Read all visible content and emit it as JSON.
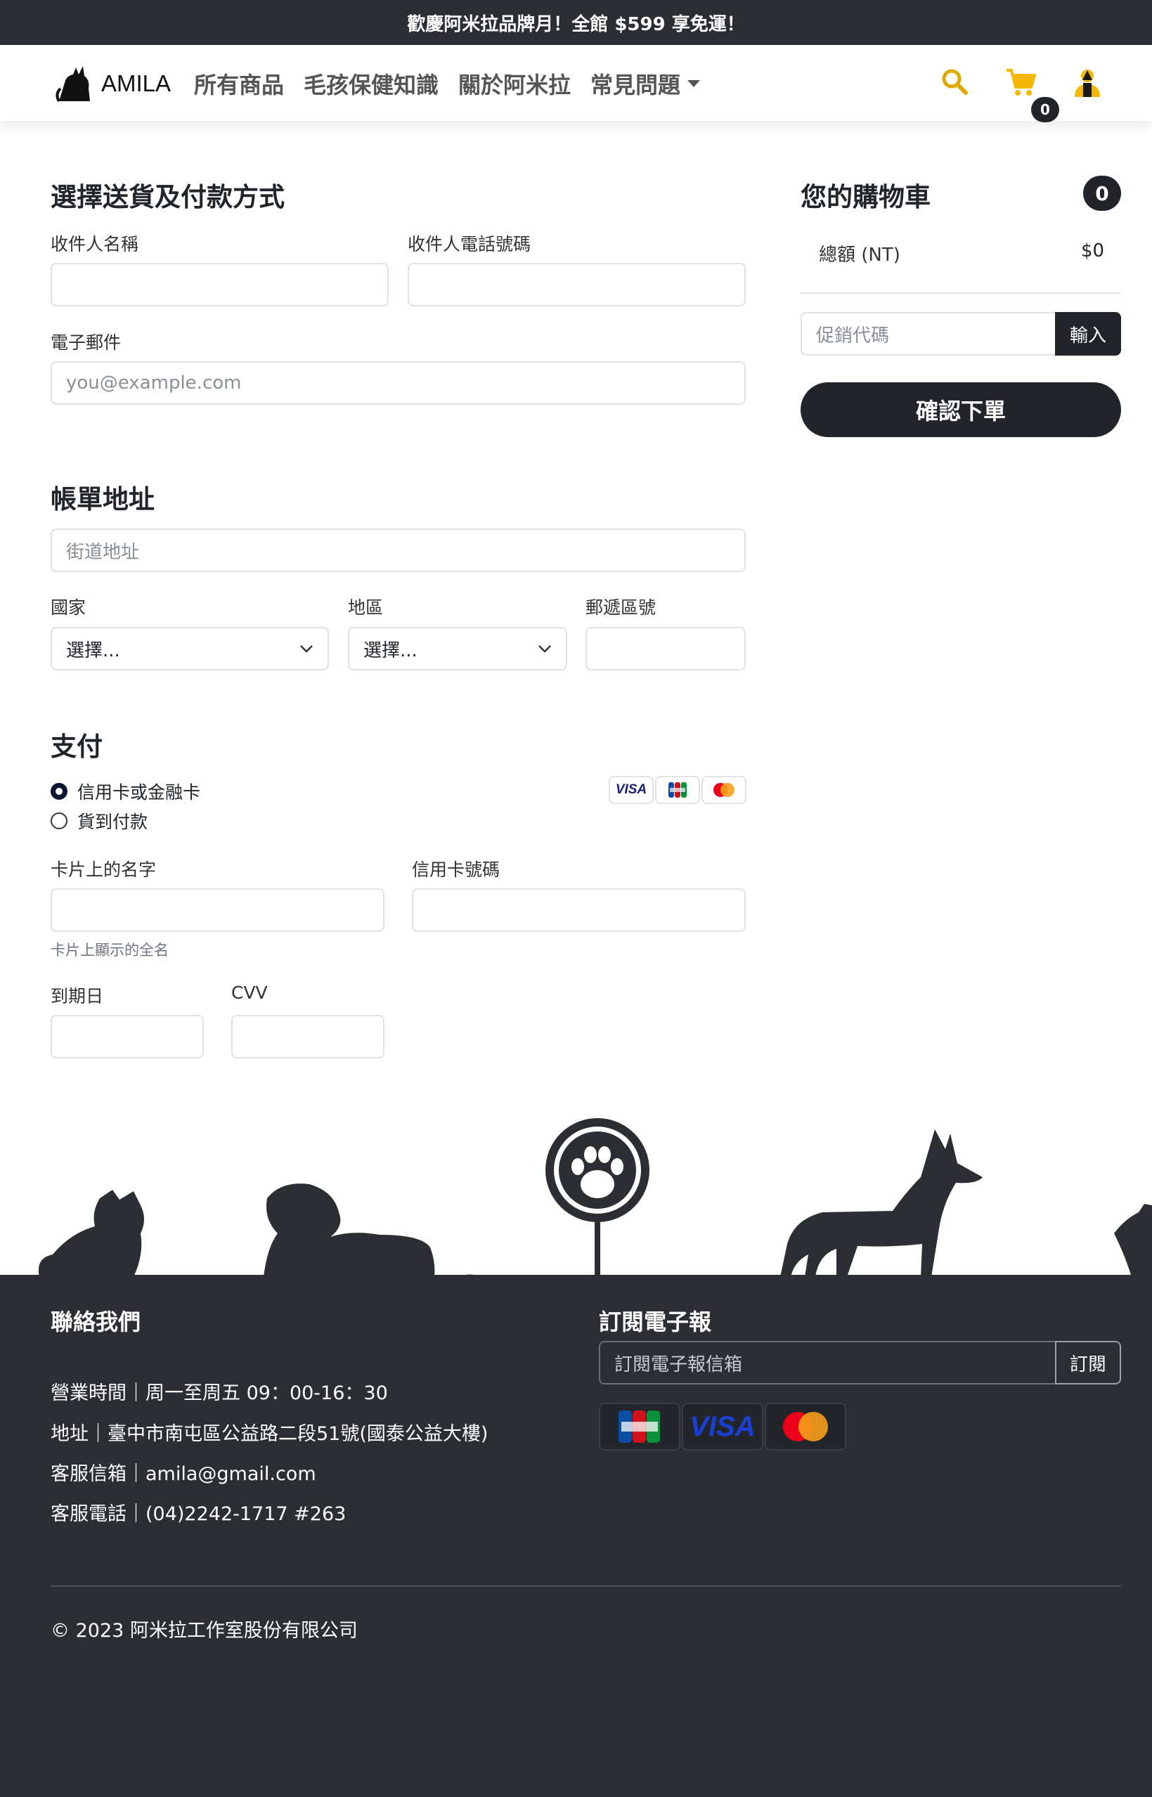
{
  "announcement": "歡慶阿米拉品牌月！全館 $599 享免運！",
  "brand": {
    "name": "AMILA"
  },
  "nav": {
    "items": [
      "所有商品",
      "毛孩保健知識",
      "關於阿米拉",
      "常見問題"
    ],
    "cart_count": "0"
  },
  "shipping": {
    "title": "選擇送貨及付款方式",
    "name_label": "收件人名稱",
    "phone_label": "收件人電話號碼",
    "email_label": "電子郵件",
    "email_placeholder": "you@example.com"
  },
  "billing": {
    "title": "帳單地址",
    "street_placeholder": "街道地址",
    "country_label": "國家",
    "country_value": "選擇...",
    "region_label": "地區",
    "region_value": "選擇...",
    "postal_label": "郵遞區號"
  },
  "payment": {
    "title": "支付",
    "options": [
      "信用卡或金融卡",
      "貨到付款"
    ],
    "selected": 0,
    "card_name_label": "卡片上的名字",
    "card_name_help": "卡片上顯示的全名",
    "card_number_label": "信用卡號碼",
    "expiry_label": "到期日",
    "cvv_label": "CVV",
    "logos": [
      "VISA",
      "JCB",
      "Mastercard"
    ]
  },
  "cart": {
    "title": "您的購物車",
    "count": "0",
    "total_label": "總額 (NT)",
    "total_value": "$0",
    "promo_placeholder": "促銷代碼",
    "promo_button": "輸入",
    "confirm_button": "確認下單"
  },
  "footer": {
    "contact_title": "聯絡我們",
    "hours": "營業時間｜周一至周五 09：00-16：30",
    "address": "地址｜臺中市南屯區公益路二段51號(國泰公益大樓)",
    "email": "客服信箱｜amila@gmail.com",
    "phone": "客服電話｜(04)2242-1717 #263",
    "newsletter_title": "訂閱電子報",
    "newsletter_placeholder": "訂閱電子報信箱",
    "subscribe_button": "訂閱",
    "copyright": "© 2023 阿米拉工作室股份有限公司"
  },
  "colors": {
    "dark": "#2b2e33",
    "accent_yellow": "#f5b800"
  }
}
